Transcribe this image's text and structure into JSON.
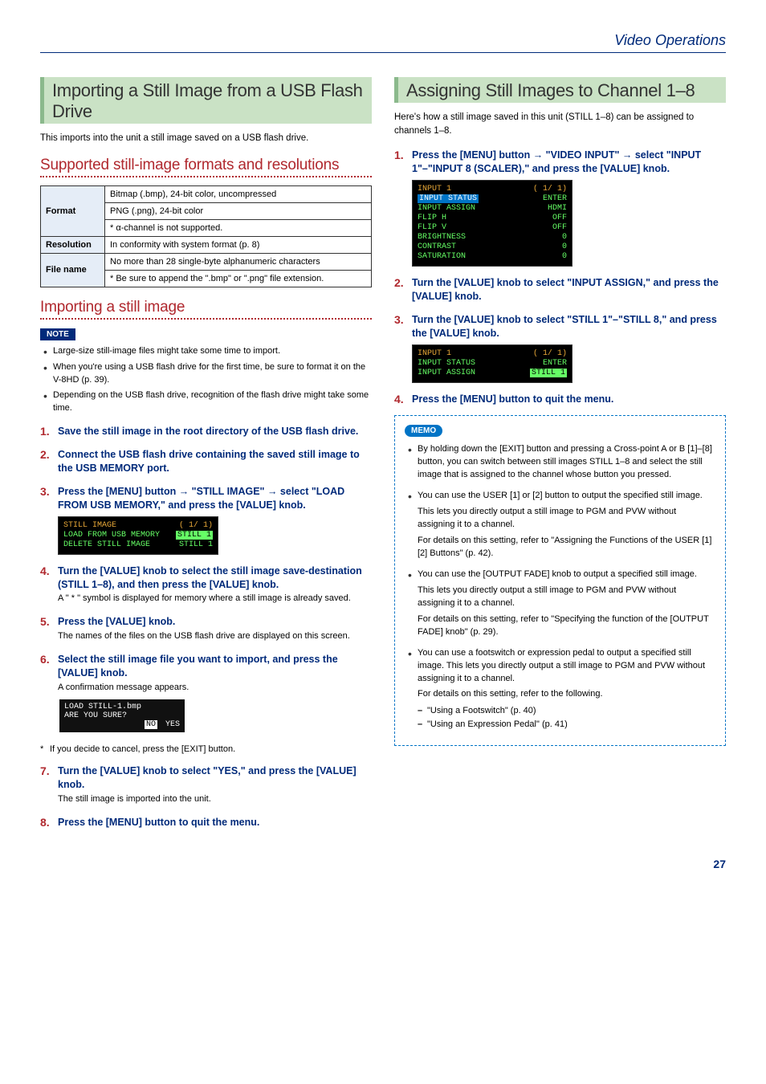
{
  "header": {
    "title": "Video Operations"
  },
  "left": {
    "sect_title": "Importing a Still Image from a USB Flash Drive",
    "intro": "This imports into the unit a still image saved on a USB flash drive.",
    "sub1_title": "Supported still-image formats and resolutions",
    "table": {
      "rows": [
        {
          "head": "Format",
          "cells": [
            "Bitmap (.bmp), 24-bit color, uncompressed",
            "PNG (.png), 24-bit color",
            "* α-channel is not supported."
          ]
        },
        {
          "head": "Resolution",
          "cells": [
            "In conformity with system format (p. 8)"
          ]
        },
        {
          "head": "File name",
          "cells": [
            "No more than 28 single-byte alphanumeric characters",
            "* Be sure to append the \".bmp\" or \".png\" file extension."
          ]
        }
      ]
    },
    "sub2_title": "Importing a still image",
    "note_badge": "NOTE",
    "note_bullets": [
      "Large-size still-image files might take some time to import.",
      "When you're using a USB flash drive for the first time, be sure to format it on the V-8HD (p. 39).",
      "Depending on the USB flash drive, recognition of the flash drive might take some time."
    ],
    "steps": [
      {
        "num": "1",
        "instr": "Save the still image in the root directory of the USB flash drive."
      },
      {
        "num": "2",
        "instr": "Connect the USB flash drive containing the saved still image to the USB MEMORY port."
      },
      {
        "num": "3",
        "instr_a": "Press the [MENU] button ",
        "instr_b": " \"STILL IMAGE\" ",
        "instr_c": " select \"LOAD FROM USB MEMORY,\" and press the [VALUE] knob.",
        "screen": {
          "title": "STILL IMAGE",
          "page": "( 1/ 1)",
          "rows": [
            {
              "l": "LOAD FROM USB MEMORY",
              "r": "STILL 1",
              "sel": true
            },
            {
              "l": " ",
              "r": " "
            },
            {
              "l": "DELETE STILL IMAGE",
              "r": "STILL 1"
            }
          ]
        }
      },
      {
        "num": "4",
        "instr": "Turn the [VALUE] knob to select the still image save-destination (STILL 1–8), and then press the [VALUE] knob.",
        "body": "A \" * \" symbol is displayed for memory where a still image is already saved."
      },
      {
        "num": "5",
        "instr": "Press the [VALUE] knob.",
        "body": "The names of the files on the USB flash drive are displayed on this screen."
      },
      {
        "num": "6",
        "instr": "Select the still image file you want to import, and press the [VALUE] knob.",
        "body": "A confirmation message appears.",
        "dialog": {
          "line1": "LOAD STILL-1.bmp",
          "line2": "ARE YOU SURE?",
          "no": "NO",
          "yes": "YES"
        }
      },
      {
        "num": "7",
        "instr": "Turn the [VALUE] knob to select \"YES,\" and press the [VALUE] knob.",
        "body": "The still image is imported into the unit."
      },
      {
        "num": "8",
        "instr": "Press the [MENU] button to quit the menu."
      }
    ],
    "cancel_note": "If you decide to cancel, press the [EXIT] button."
  },
  "right": {
    "sect_title": "Assigning Still Images to Channel 1–8",
    "intro": "Here's how a still image saved in this unit (STILL 1–8) can be assigned to channels 1–8.",
    "steps": [
      {
        "num": "1",
        "instr_a": "Press the [MENU] button ",
        "instr_b": " \"VIDEO INPUT\" ",
        "instr_c": " select \"INPUT 1\"–\"INPUT 8 (SCALER),\" and press the [VALUE] knob.",
        "screen": {
          "title": "INPUT 1",
          "page": "( 1/ 1)",
          "rows": [
            {
              "l": "INPUT STATUS",
              "r": "ENTER",
              "hl": true
            },
            {
              "l": "INPUT ASSIGN",
              "r": "HDMI"
            },
            {
              "l": "FLIP H",
              "r": "OFF"
            },
            {
              "l": "FLIP V",
              "r": "OFF"
            },
            {
              "l": "BRIGHTNESS",
              "r": "0"
            },
            {
              "l": "CONTRAST",
              "r": "0"
            },
            {
              "l": "SATURATION",
              "r": "0"
            }
          ]
        }
      },
      {
        "num": "2",
        "instr": "Turn the [VALUE] knob to select \"INPUT ASSIGN,\" and press the [VALUE] knob."
      },
      {
        "num": "3",
        "instr": "Turn the [VALUE] knob to select \"STILL 1\"–\"STILL 8,\" and press the [VALUE] knob.",
        "screen": {
          "title": "INPUT 1",
          "page": "( 1/ 1)",
          "rows": [
            {
              "l": "INPUT STATUS",
              "r": "ENTER"
            },
            {
              "l": "INPUT ASSIGN",
              "r": "STILL 1",
              "sel": true
            }
          ]
        }
      },
      {
        "num": "4",
        "instr": "Press the [MENU] button to quit the menu."
      }
    ],
    "memo_badge": "MEMO",
    "memo": [
      {
        "lead": "By holding down the [EXIT] button and pressing a Cross-point A or B [1]–[8] button, you can switch between still images STILL 1–8 and select the still image that is assigned to the channel whose button you pressed."
      },
      {
        "lead": "You can use the USER [1] or [2] button to output the specified still image.",
        "paras": [
          "This lets you directly output a still image to PGM and PVW without assigning it to a channel.",
          "For details on this setting, refer to \"Assigning the Functions of the USER [1] [2] Buttons\" (p. 42)."
        ]
      },
      {
        "lead": "You can use the [OUTPUT FADE] knob to output a specified still image.",
        "paras": [
          "This lets you directly output a still image to PGM and PVW without assigning it to a channel.",
          "For details on this setting, refer to \"Specifying the function of the [OUTPUT FADE] knob\" (p. 29)."
        ]
      },
      {
        "lead": "You can use a footswitch or expression pedal to output a specified still image. This lets you directly output a still image to PGM and PVW without assigning it to a channel.",
        "paras": [
          "For details on this setting, refer to the following."
        ],
        "sub": [
          "\"Using a Footswitch\" (p. 40)",
          "\"Using an Expression Pedal\" (p. 41)"
        ]
      }
    ]
  },
  "page_num": "27"
}
